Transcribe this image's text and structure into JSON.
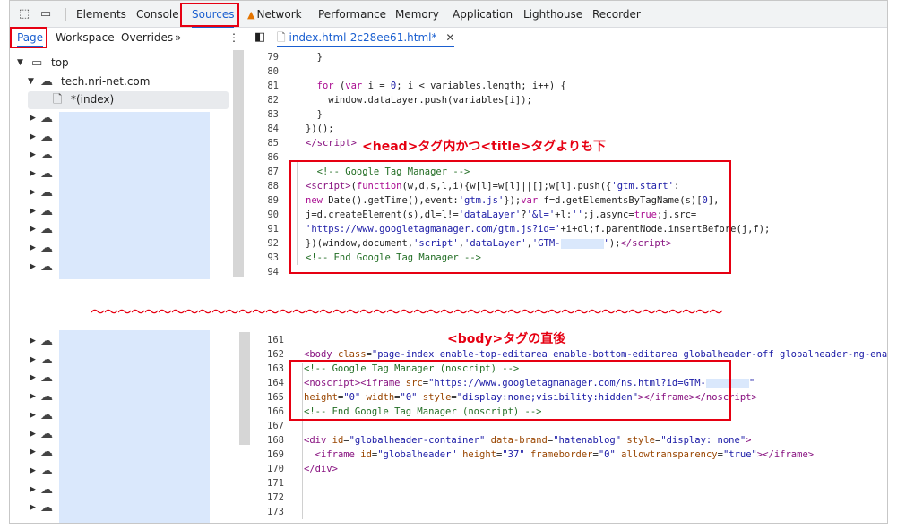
{
  "top_tabs": [
    "Elements",
    "Console",
    "Sources",
    "Network",
    "Performance",
    "Memory",
    "Application",
    "Lighthouse",
    "Recorder"
  ],
  "toolbar_icons": [
    "inspect-icon",
    "device-toggle-icon"
  ],
  "sub_tabs": [
    "Page",
    "Workspace",
    "Overrides",
    "»"
  ],
  "more_icon": "⋮",
  "file_tab": {
    "name": "index.html-2c28ee61.html*",
    "close": "✕"
  },
  "tree": {
    "top": "top",
    "domain": "tech.nri-net.com",
    "index": "*(index)"
  },
  "annotations": {
    "head": "<head>タグ内かつ<title>タグよりも下",
    "body": "<body>タグの直後",
    "wave": "～～～～～～～～～～～～～～～～～～～～～～～～～～～～～～～～～～～～～～～～～～～～～～～"
  },
  "code_top": {
    "line_numbers": [
      "79",
      "80",
      "81",
      "82",
      "83",
      "84",
      "85",
      "86",
      "87",
      "88",
      "89",
      "90",
      "91",
      "92",
      "93",
      "94"
    ]
  },
  "code_bottom": {
    "line_numbers": [
      "161",
      "162",
      "163",
      "164",
      "165",
      "166",
      "167",
      "168",
      "169",
      "170",
      "171",
      "172",
      "173"
    ]
  },
  "colors": {
    "accent": "#1a5fd0",
    "highlight_box": "#e60012",
    "mask": "#dae8fc"
  }
}
